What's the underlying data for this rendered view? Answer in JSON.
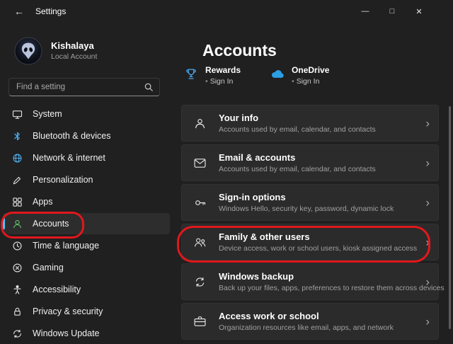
{
  "window": {
    "title": "Settings",
    "back_glyph": "←",
    "controls": {
      "minimize": "—",
      "maximize": "□",
      "close": "✕"
    }
  },
  "user": {
    "name": "Kishalaya",
    "type": "Local Account"
  },
  "search": {
    "placeholder": "Find a setting",
    "icon": "search-icon"
  },
  "sidebar": {
    "items": [
      {
        "label": "System",
        "icon": "system-icon"
      },
      {
        "label": "Bluetooth & devices",
        "icon": "bluetooth-icon"
      },
      {
        "label": "Network & internet",
        "icon": "network-icon"
      },
      {
        "label": "Personalization",
        "icon": "personalization-icon"
      },
      {
        "label": "Apps",
        "icon": "apps-icon"
      },
      {
        "label": "Accounts",
        "icon": "accounts-icon",
        "selected": true,
        "annotated": true
      },
      {
        "label": "Time & language",
        "icon": "time-language-icon"
      },
      {
        "label": "Gaming",
        "icon": "gaming-icon"
      },
      {
        "label": "Accessibility",
        "icon": "accessibility-icon"
      },
      {
        "label": "Privacy & security",
        "icon": "privacy-icon"
      },
      {
        "label": "Windows Update",
        "icon": "windows-update-icon"
      }
    ]
  },
  "main": {
    "title": "Accounts",
    "chevron": "›",
    "promos": [
      {
        "label": "Rewards",
        "bullet": "•",
        "status": "Sign In",
        "icon": "rewards-icon"
      },
      {
        "label": "OneDrive",
        "bullet": "•",
        "status": "Sign In",
        "icon": "onedrive-icon"
      }
    ],
    "cards": [
      {
        "title": "Your info",
        "subtitle": "Accounts used by email, calendar, and contacts",
        "icon": "your-info-icon"
      },
      {
        "title": "Email & accounts",
        "subtitle": "Accounts used by email, calendar, and contacts",
        "icon": "email-accounts-icon"
      },
      {
        "title": "Sign-in options",
        "subtitle": "Windows Hello, security key, password, dynamic lock",
        "icon": "sign-in-options-icon"
      },
      {
        "title": "Family & other users",
        "subtitle": "Device access, work or school users, kiosk assigned access",
        "icon": "family-icon",
        "annotated": true
      },
      {
        "title": "Windows backup",
        "subtitle": "Back up your files, apps, preferences to restore them across devices",
        "icon": "windows-backup-icon"
      },
      {
        "title": "Access work or school",
        "subtitle": "Organization resources like email, apps, and network",
        "icon": "work-school-icon"
      }
    ]
  },
  "colors": {
    "annotation_red": "#e0181c",
    "accent_blue": "#4cc2ff",
    "onedrive_blue": "#2b9fe6",
    "card_bg": "#2b2b2b",
    "page_bg": "#202020"
  }
}
